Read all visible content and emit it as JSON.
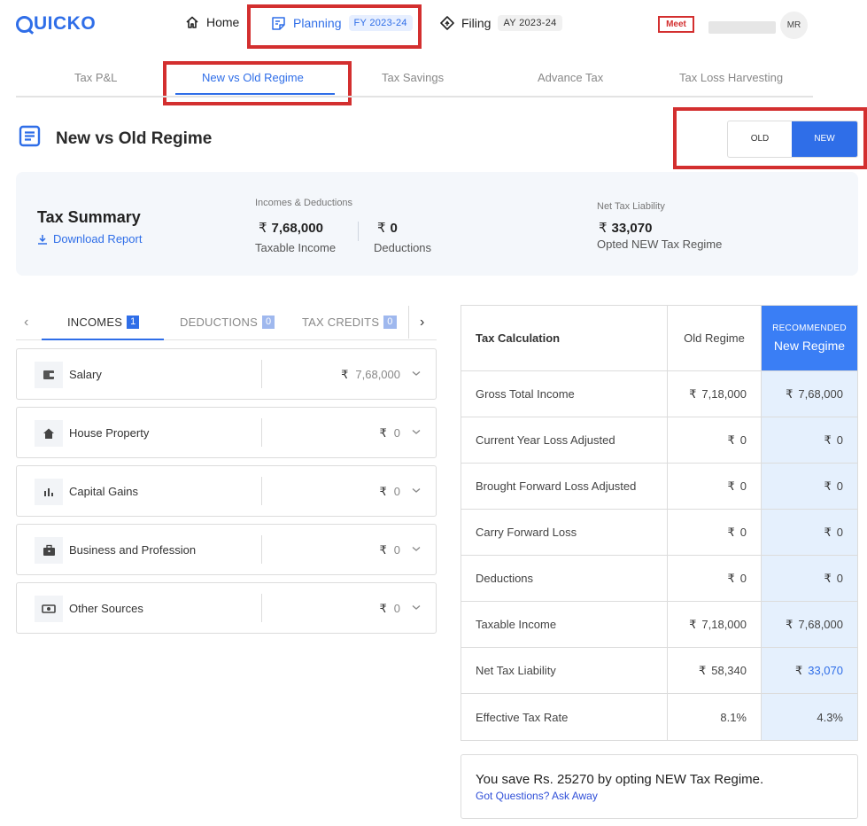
{
  "brand": {
    "logo_text": "UICKO"
  },
  "topnav": {
    "home_label": "Home",
    "planning_label": "Planning",
    "planning_badge": "FY 2023-24",
    "filing_label": "Filing",
    "filing_badge": "AY 2023-24",
    "meet_label": "Meet",
    "avatar_initials": "MR"
  },
  "subtabs": [
    "Tax P&L",
    "New vs Old Regime",
    "Tax Savings",
    "Advance Tax",
    "Tax Loss Harvesting"
  ],
  "page": {
    "title": "New vs Old Regime"
  },
  "regime_toggle": {
    "old_label": "OLD",
    "new_label": "NEW",
    "selected": "NEW"
  },
  "summary": {
    "title": "Tax Summary",
    "download_label": "Download Report",
    "incomes_heading": "Incomes & Deductions",
    "taxable_income_value": "7,68,000",
    "taxable_income_label": "Taxable Income",
    "deductions_value": "0",
    "deductions_label": "Deductions",
    "net_heading": "Net Tax Liability",
    "net_value": "33,070",
    "net_label": "Opted NEW Tax Regime",
    "currency_symbol": "₹"
  },
  "left_tabs": [
    {
      "label": "INCOMES",
      "count": "1"
    },
    {
      "label": "DEDUCTIONS",
      "count": "0"
    },
    {
      "label": "TAX CREDITS",
      "count": "0"
    }
  ],
  "incomes": [
    {
      "label": "Salary",
      "value": "7,68,000",
      "icon": "wallet-icon"
    },
    {
      "label": "House Property",
      "value": "0",
      "icon": "home-icon"
    },
    {
      "label": "Capital Gains",
      "value": "0",
      "icon": "bar-chart-icon"
    },
    {
      "label": "Business and Profession",
      "value": "0",
      "icon": "briefcase-icon"
    },
    {
      "label": "Other Sources",
      "value": "0",
      "icon": "cash-icon"
    }
  ],
  "tax_table": {
    "header": {
      "col1": "Tax Calculation",
      "col2": "Old Regime",
      "recommended": "RECOMMENDED",
      "col3": "New Regime"
    },
    "rows": [
      {
        "label": "Gross Total Income",
        "old": "7,18,000",
        "new": "7,68,000"
      },
      {
        "label": "Current Year Loss Adjusted",
        "old": "0",
        "new": "0"
      },
      {
        "label": "Brought Forward Loss Adjusted",
        "old": "0",
        "new": "0"
      },
      {
        "label": "Carry Forward Loss",
        "old": "0",
        "new": "0"
      },
      {
        "label": "Deductions",
        "old": "0",
        "new": "0"
      },
      {
        "label": "Taxable Income",
        "old": "7,18,000",
        "new": "7,68,000"
      },
      {
        "label": "Net Tax Liability",
        "old": "58,340",
        "new": "33,070"
      },
      {
        "label": "Effective Tax Rate",
        "old": "8.1%",
        "new": "4.3%"
      }
    ]
  },
  "savings": {
    "message": "You save Rs. 25270 by opting NEW Tax Regime.",
    "link": "Got Questions? Ask Away"
  },
  "colors": {
    "accent": "#2f6ee8",
    "highlight": "#d32f2f",
    "recommended_bg": "#e5f0fd"
  }
}
